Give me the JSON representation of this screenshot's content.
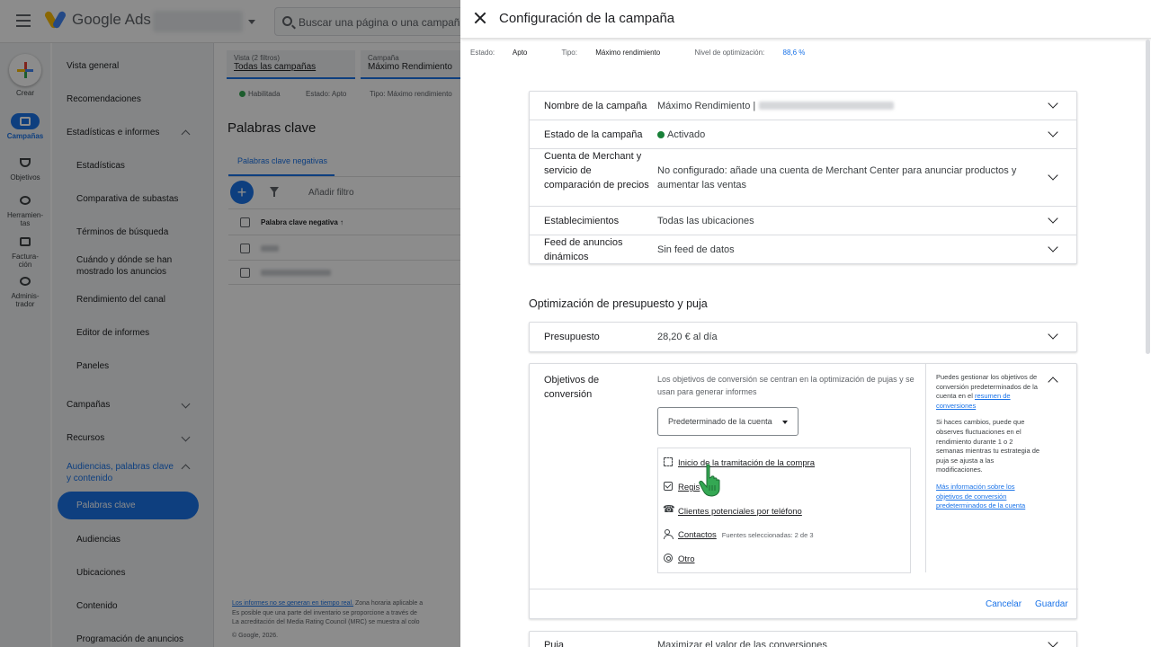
{
  "app": {
    "logo_text": "Google Ads",
    "search_placeholder": "Buscar una página o una campaña"
  },
  "rail": [
    {
      "label": "Crear"
    },
    {
      "label": "Campañas"
    },
    {
      "label": "Objetivos"
    },
    {
      "label": "Herramien-tas"
    },
    {
      "label": "Factura-ción"
    },
    {
      "label": "Adminis-trador"
    }
  ],
  "sidenav": {
    "vista_general": "Vista general",
    "recomendaciones": "Recomendaciones",
    "estadisticas_group": "Estadísticas e informes",
    "estadisticas": "Estadísticas",
    "comparativa": "Comparativa de subastas",
    "terminos": "Términos de búsqueda",
    "cuando_donde": "Cuándo y dónde se han mostrado los anuncios",
    "rendimiento": "Rendimiento del canal",
    "editor": "Editor de informes",
    "paneles": "Paneles",
    "campanas": "Campañas",
    "recursos": "Recursos",
    "audiencias_group": "Audiencias, palabras clave y contenido",
    "palabras_clave": "Palabras clave",
    "audiencias": "Audiencias",
    "ubicaciones": "Ubicaciones",
    "contenido": "Contenido",
    "programacion": "Programación de anuncios"
  },
  "content": {
    "view_label": "Vista (2 filtros)",
    "view_value": "Todas las campañas",
    "campaign_label": "Campaña",
    "campaign_value": "Máximo Rendimiento",
    "status_enabled": "Habilitada",
    "status_state": "Estado: Apto",
    "status_type": "Tipo: Máximo rendimiento",
    "page_title": "Palabras clave",
    "tab": "Palabras clave negativas",
    "add_filter": "Añadir filtro",
    "column_header": "Palabra clave negativa",
    "footer_link": "Los informes no se generan en tiempo real.",
    "footer_1": "Zona horaria aplicable a",
    "footer_2": "Es posible que una parte del inventario se proporcione a través de",
    "footer_3": "La acreditación del Media Rating Council (MRC) se muestra al colo",
    "footer_4": "© Google, 2026."
  },
  "panel": {
    "title": "Configuración de la campaña",
    "status_estado_label": "Estado:",
    "status_estado_value": "Apto",
    "status_tipo_label": "Tipo:",
    "status_tipo_value": "Máximo rendimiento",
    "status_nivel_label": "Nivel de optimización:",
    "status_nivel_value": "88,6 %",
    "settings": [
      {
        "key": "Nombre de la campaña",
        "value": "Máximo Rendimiento |"
      },
      {
        "key": "Estado de la campaña",
        "value": "Activado"
      },
      {
        "key": "Cuenta de Merchant y servicio de comparación de precios",
        "value": "No configurado: añade una cuenta de Merchant Center para anunciar productos y aumentar las ventas"
      },
      {
        "key": "Establecimientos",
        "value": "Todas las ubicaciones"
      },
      {
        "key": "Feed de anuncios dinámicos",
        "value": "Sin feed de datos"
      }
    ],
    "budget_section_title": "Optimización de presupuesto y puja",
    "budget_key": "Presupuesto",
    "budget_value": "28,20 € al día",
    "conv": {
      "key": "Objetivos de conversión",
      "description": "Los objetivos de conversión se centran en la optimización de pujas y se usan para generar informes",
      "select_value": "Predeterminado de la cuenta",
      "goals": [
        {
          "label": "Inicio de la tramitación de la compra",
          "icon": "cart-icon"
        },
        {
          "label": "Regis",
          "icon": "checkbox-icon"
        },
        {
          "label": "Clientes potenciales por teléfono",
          "icon": "phone-icon"
        },
        {
          "label": "Contactos",
          "icon": "people-icon",
          "note": "Fuentes seleccionadas: 2 de 3"
        },
        {
          "label": "Otro",
          "icon": "target-icon"
        }
      ],
      "info_1_pre": "Puedes gestionar los objetivos de conversión predeterminados de la cuenta en el",
      "info_1_link": "resumen de conversiones",
      "info_2": "Si haces cambios, puede que observes fluctuaciones en el rendimiento durante 1 o 2 semanas mientras tu estrategia de puja se ajusta a las modificaciones.",
      "info_3_link": "Más información sobre los objetivos de conversión predeterminados de la cuenta",
      "cancel": "Cancelar",
      "save": "Guardar"
    },
    "puja_key": "Puja",
    "puja_value": "Maximizar el valor de las conversiones"
  },
  "colors": {
    "accent": "#1a73e8",
    "status_green": "#188038"
  }
}
